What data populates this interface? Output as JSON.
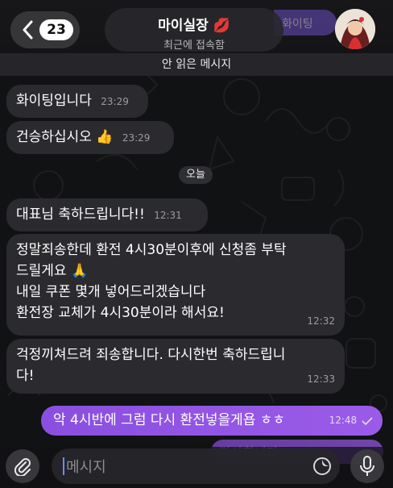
{
  "header": {
    "back_count": "23",
    "title": "마이실장",
    "title_emoji": "💋",
    "subtitle": "최근에 접속함",
    "peek_text": "화이팅"
  },
  "unread_divider": "안 읽은 메시지",
  "messages_before": [
    {
      "text": "화이팅입니다",
      "time": "23:29"
    },
    {
      "text": "건승하십시오 👍",
      "time": "23:29"
    }
  ],
  "date_divider": "오늘",
  "messages_today": [
    {
      "text": "대표님 축하드립니다!!",
      "time": "12:31"
    },
    {
      "text": "정말죄송한데 환전 4시30분이후에 신청좀 부탁\n드릴게요 🙏\n내일 쿠폰 몇개 넣어드리겠습니다\n환전장 교체가 4시30분이라 해서요!",
      "time": "12:32"
    },
    {
      "text": "걱정끼쳐드려 죄송합니다. 다시한번 축하드립니\n다!",
      "time": "12:33"
    }
  ],
  "outgoing": {
    "text": "악 4시반에 그럼 다시 환전넣을게욥 ㅎㅎ",
    "time": "12:48",
    "status": "read"
  },
  "outgoing_peek": "감사합니다",
  "composer": {
    "placeholder": "메시지"
  },
  "colors": {
    "outgoing": "#9254e4",
    "incoming": "#2b2b2f",
    "background": "#111214"
  }
}
